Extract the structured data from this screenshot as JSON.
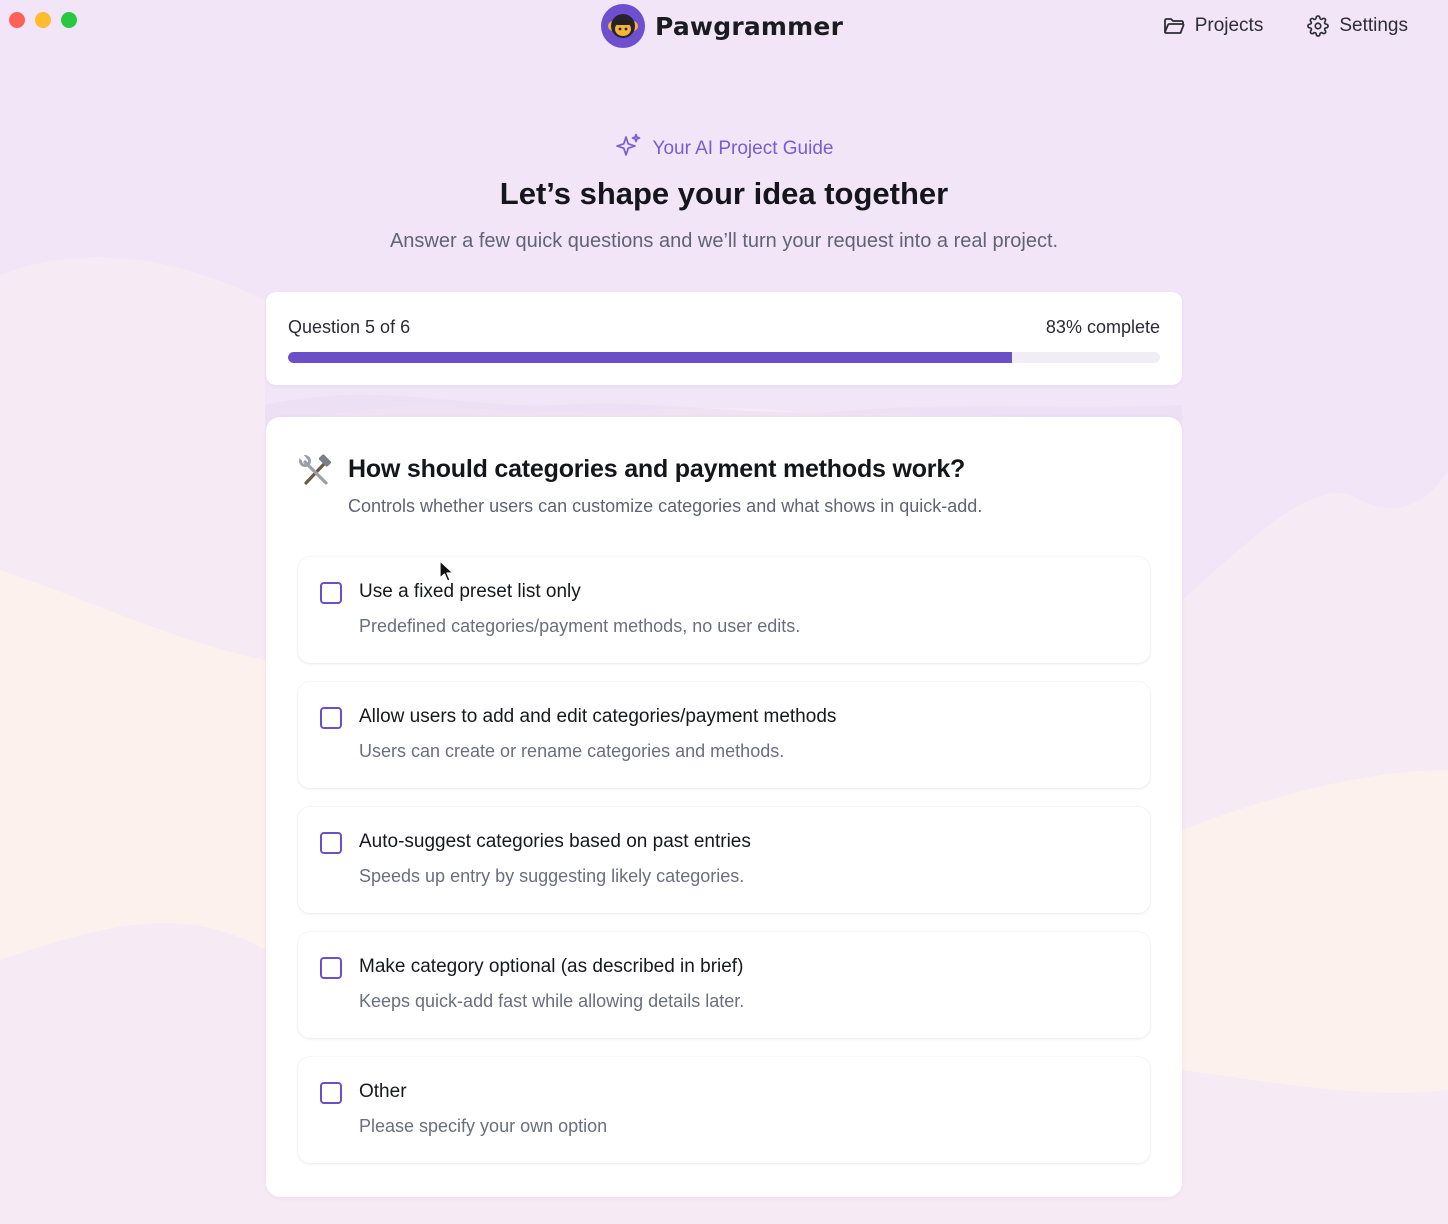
{
  "brand": {
    "name": "Pawgrammer"
  },
  "nav": {
    "projects": "Projects",
    "settings": "Settings"
  },
  "hero": {
    "guide_label": "Your AI Project Guide",
    "title": "Let’s shape your idea together",
    "subtitle": "Answer a few quick questions and we’ll turn your request into a real project."
  },
  "progress": {
    "label": "Question 5 of 6",
    "percent_label": "83% complete",
    "fraction": 0.83
  },
  "question": {
    "title": "How should categories and payment methods work?",
    "description": "Controls whether users can customize categories and what shows in quick-add.",
    "options": [
      {
        "title": "Use a fixed preset list only",
        "description": "Predefined categories/payment methods, no user edits."
      },
      {
        "title": "Allow users to add and edit categories/payment methods",
        "description": "Users can create or rename categories and methods."
      },
      {
        "title": "Auto-suggest categories based on past entries",
        "description": "Speeds up entry by suggesting likely categories."
      },
      {
        "title": "Make category optional (as described in brief)",
        "description": "Keeps quick-add fast while allowing details later."
      },
      {
        "title": "Other",
        "description": "Please specify your own option"
      }
    ]
  },
  "icons": {
    "guide": "sparkles-icon",
    "question": "hammer-and-wrench-icon",
    "projects": "folder-icon",
    "settings": "gear-icon"
  },
  "colors": {
    "accent": "#6a4fc8",
    "background": "#f1e5f7"
  }
}
